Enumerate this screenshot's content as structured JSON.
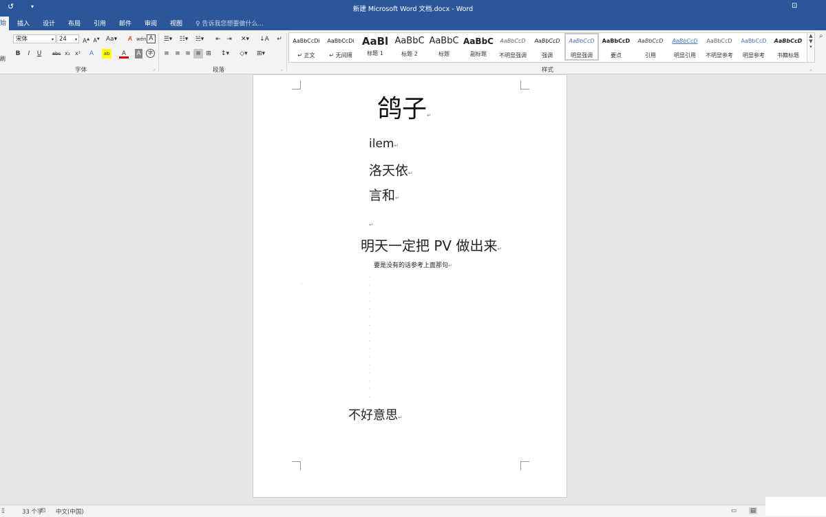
{
  "window": {
    "title": "新建 Microsoft Word 文档.docx - Word"
  },
  "tabs": [
    {
      "label": "始"
    },
    {
      "label": "插入"
    },
    {
      "label": "设计"
    },
    {
      "label": "布局"
    },
    {
      "label": "引用"
    },
    {
      "label": "邮件"
    },
    {
      "label": "审阅"
    },
    {
      "label": "视图"
    }
  ],
  "tell_me": "告诉我您想要做什么...",
  "ribbon": {
    "font_name": "宋体",
    "font_size": "24",
    "group_font": "字体",
    "group_paragraph": "段落",
    "group_styles": "样式",
    "brush_label": "刷"
  },
  "styles_gallery": [
    {
      "preview": "AaBbCcDi",
      "name": "↵ 正文"
    },
    {
      "preview": "AaBbCcDi",
      "name": "↵ 无间隔"
    },
    {
      "preview": "AaBl",
      "name": "标题 1"
    },
    {
      "preview": "AaBbC",
      "name": "标题 2"
    },
    {
      "preview": "AaBbC",
      "name": "标题"
    },
    {
      "preview": "AaBbC",
      "name": "副标题"
    },
    {
      "preview": "AaBbCcD",
      "name": "不明显强调"
    },
    {
      "preview": "AaBbCcD",
      "name": "强调"
    },
    {
      "preview": "AaBbCcD",
      "name": "明显强调"
    },
    {
      "preview": "AaBbCcD",
      "name": "要点"
    },
    {
      "preview": "AaBbCcD",
      "name": "引用"
    },
    {
      "preview": "AaBbCcD",
      "name": "明显引用"
    },
    {
      "preview": "AaBbCcD",
      "name": "不明显参考"
    },
    {
      "preview": "AaBbCcD",
      "name": "明显参考"
    },
    {
      "preview": "AaBbCcD",
      "name": "书籍标题"
    }
  ],
  "document": {
    "title": "鸽子",
    "names": [
      "ilem",
      "洛天依",
      "言和"
    ],
    "line_main": "明天一定把 PV 做出来",
    "line_small": "要是没有的话参考上面那句",
    "line_last": "不好意思",
    "para_mark": "↵"
  },
  "status": {
    "word_count": "33 个字",
    "language": "中文(中国)"
  },
  "colors": {
    "titlebar": "#2b579a",
    "ribbon": "#f3f3f3",
    "canvas": "#e6e6e6"
  }
}
